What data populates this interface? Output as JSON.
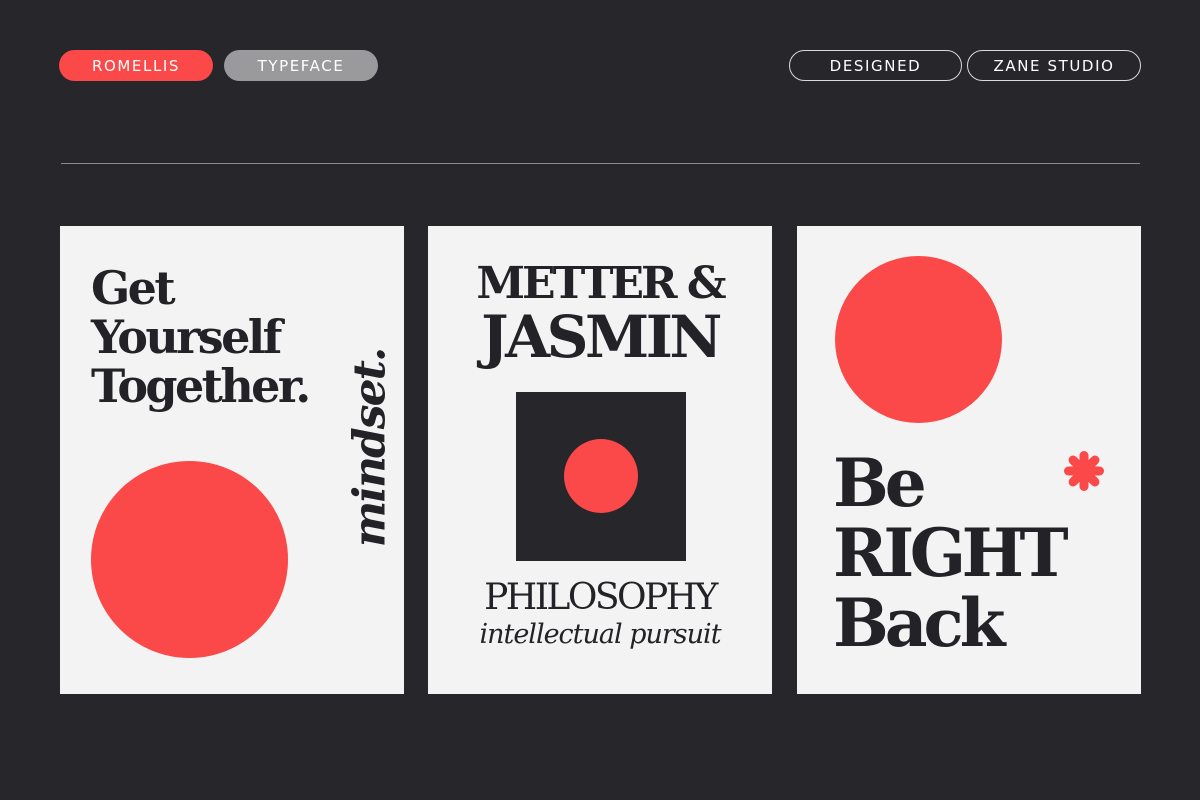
{
  "header": {
    "tags_left": [
      "ROMELLIS",
      "TYPEFACE"
    ],
    "tags_right": [
      "DESIGNED",
      "ZANE STUDIO"
    ]
  },
  "posters": [
    {
      "headline": [
        "Get",
        "Yourself",
        "Together."
      ],
      "vertical_word": "mindset."
    },
    {
      "headline": [
        "METTER &",
        "JASMIN"
      ],
      "subtitle": "PHILOSOPHY",
      "tagline": "intellectual pursuit"
    },
    {
      "headline": [
        "Be",
        "RIGHT",
        "Back"
      ]
    }
  ],
  "colors": {
    "background": "#26262b",
    "accent": "#fb4848",
    "poster": "#f3f3f3",
    "ink": "#232327",
    "pill_gray": "#9a9a9c"
  }
}
